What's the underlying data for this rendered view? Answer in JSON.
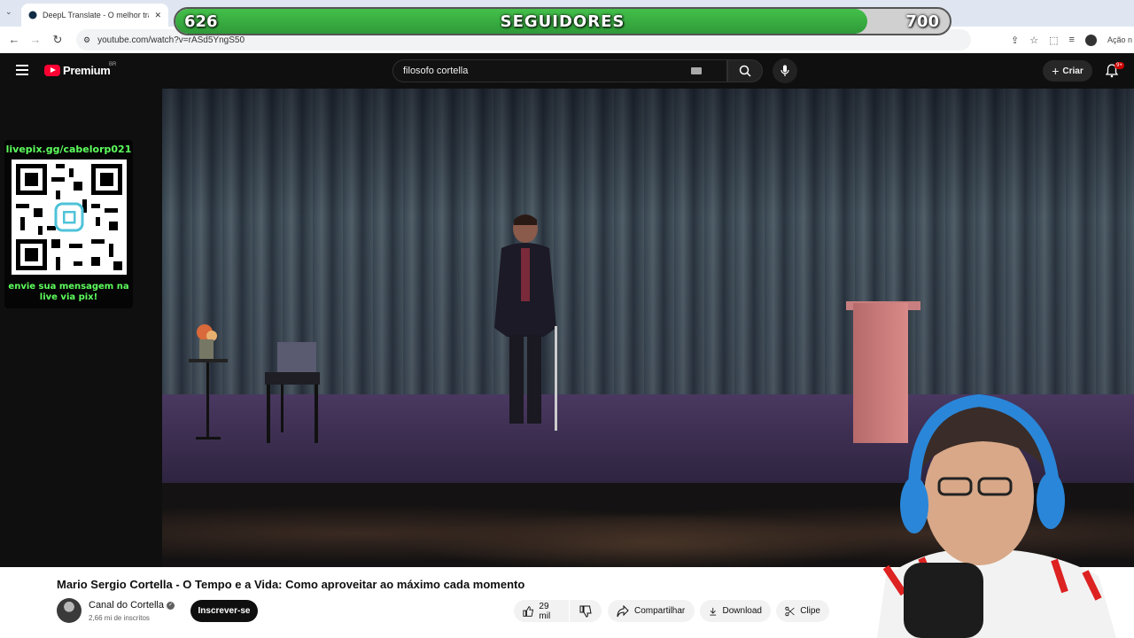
{
  "browser": {
    "tab_title": "DeepL Translate - O melhor tra",
    "url": "youtube.com/watch?v=rASd5YngS50",
    "profile_action": "Ação n"
  },
  "overlay": {
    "followers_current": "626",
    "followers_label": "SEGUIDORES",
    "followers_goal": "700",
    "progress_fraction": 0.894,
    "pix_url": "livepix.gg/cabelorp021",
    "pix_message": "envie sua mensagem na live via pix!"
  },
  "youtube": {
    "logo_text": "Premium",
    "logo_region": "BR",
    "search_query": "filosofo cortella",
    "create_label": "Criar",
    "notifications_badge": "9+"
  },
  "video": {
    "title": "Mario Sergio Cortella - O Tempo e a Vida: Como aproveitar ao máximo cada momento",
    "channel_name": "Canal do Cortella",
    "subscribers": "2,66 mi de inscritos",
    "subscribe_label": "Inscrever-se",
    "likes": "29 mil",
    "share_label": "Compartilhar",
    "download_label": "Download",
    "clip_label": "Clipe"
  },
  "colors": {
    "progress_green": "#3bb043",
    "pix_green": "#5dff5d",
    "yt_red": "#ff0033"
  }
}
